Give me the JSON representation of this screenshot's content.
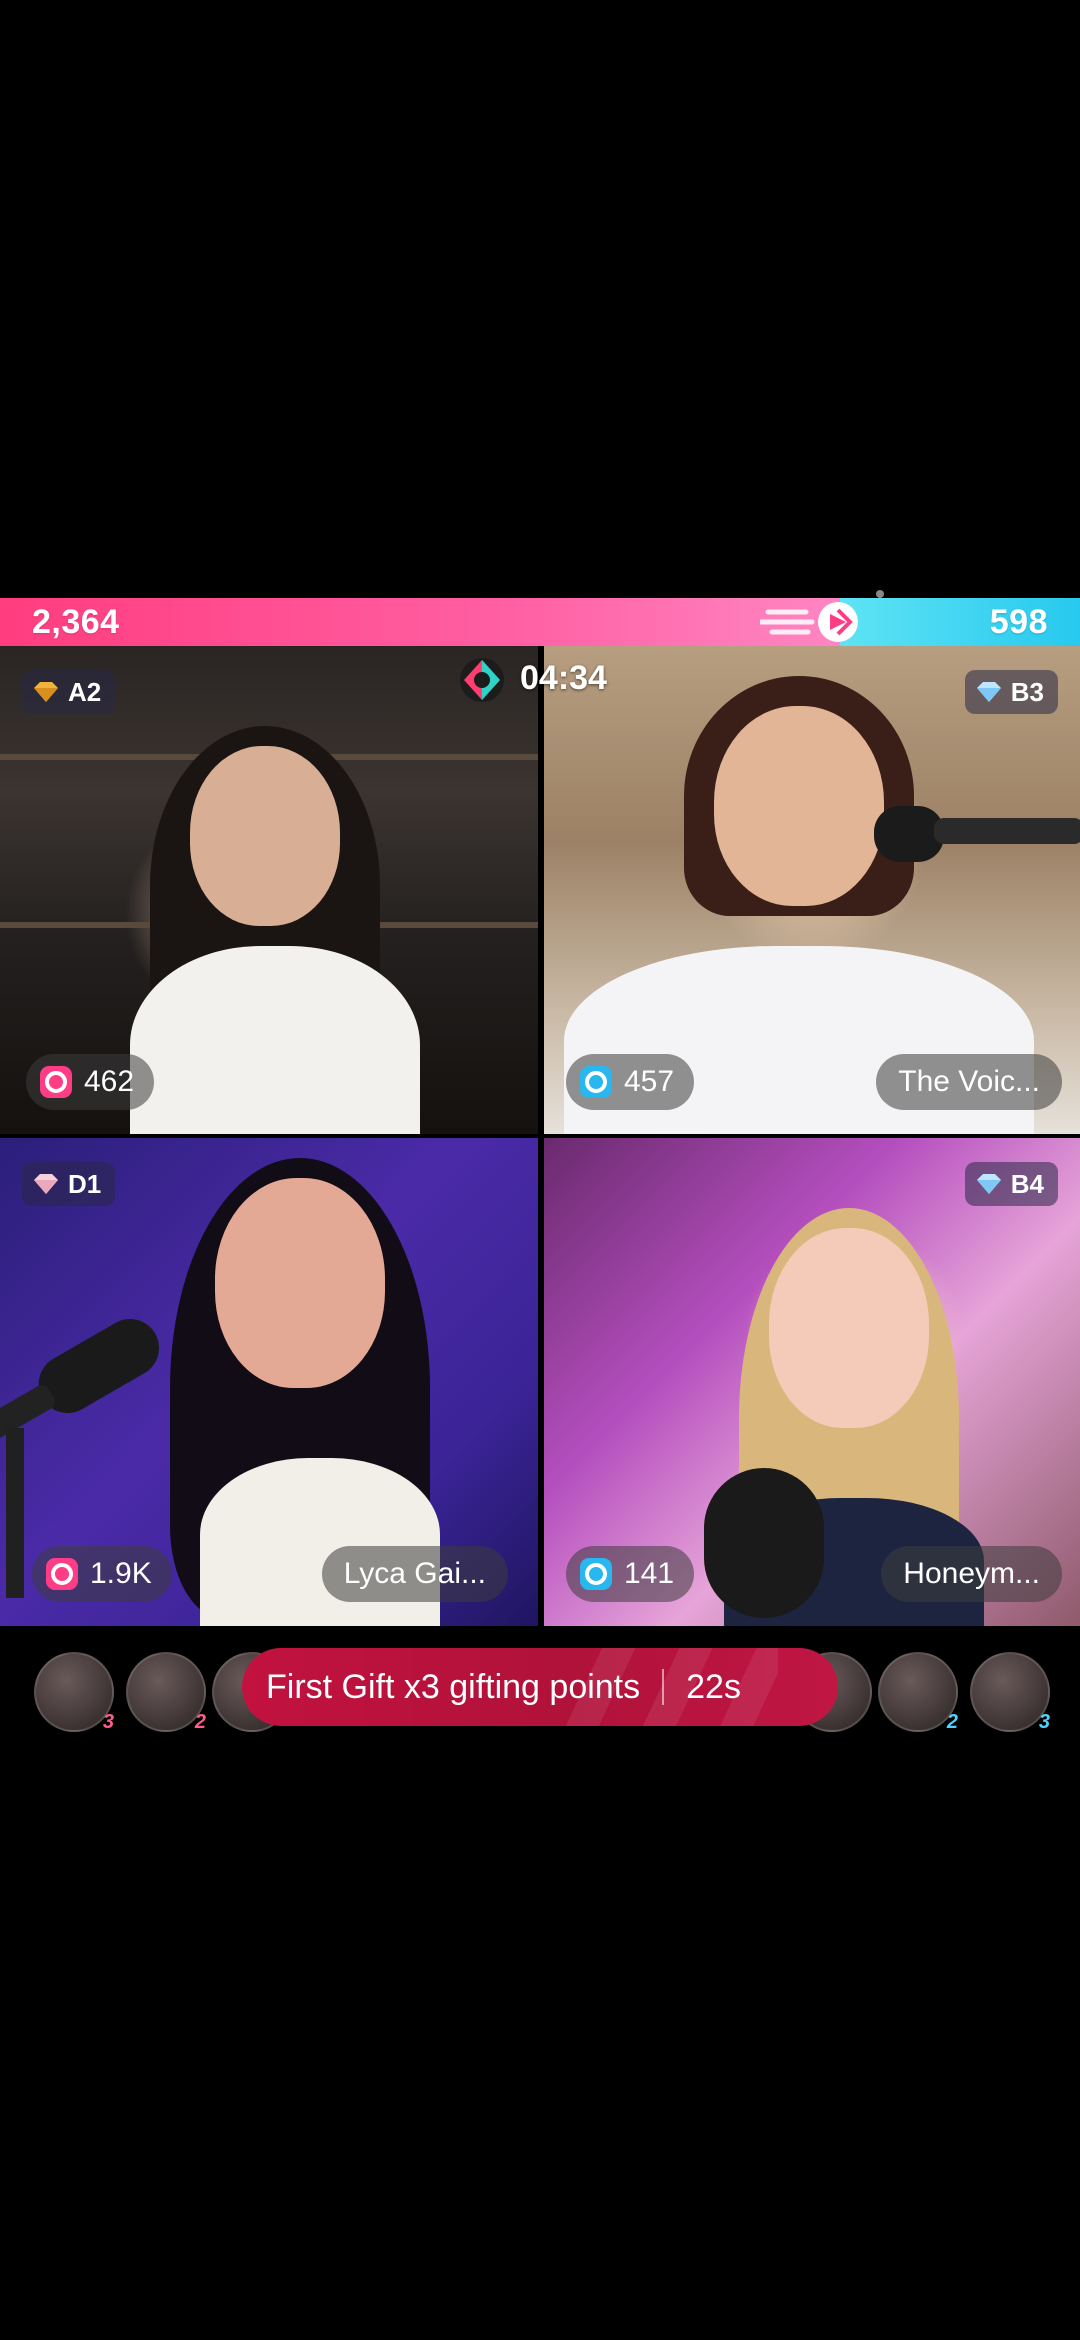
{
  "battle": {
    "score_left": "2,364",
    "score_right": "598",
    "timer": "04:34",
    "colors": {
      "pink": "#ff3d86",
      "blue": "#28b7ee",
      "promo": "#b0123a"
    }
  },
  "tiles": [
    {
      "badge": "A2",
      "badge_gem": "gold-diamond-icon",
      "points": "462",
      "points_icon": "pink",
      "name": ""
    },
    {
      "badge": "B3",
      "badge_gem": "blue-diamond-icon",
      "points": "457",
      "points_icon": "blue",
      "name": "The Voic..."
    },
    {
      "badge": "D1",
      "badge_gem": "pink-diamond-icon",
      "points": "1.9K",
      "points_icon": "pink",
      "name": "Lyca Gai..."
    },
    {
      "badge": "B4",
      "badge_gem": "blue-diamond-icon",
      "points": "141",
      "points_icon": "blue",
      "name": "Honeym..."
    }
  ],
  "gifters": {
    "left_ranks": [
      "3",
      "2",
      ""
    ],
    "right_ranks": [
      "",
      "2",
      "3"
    ]
  },
  "promo": {
    "text": "First Gift x3 gifting points",
    "time": "22s"
  }
}
